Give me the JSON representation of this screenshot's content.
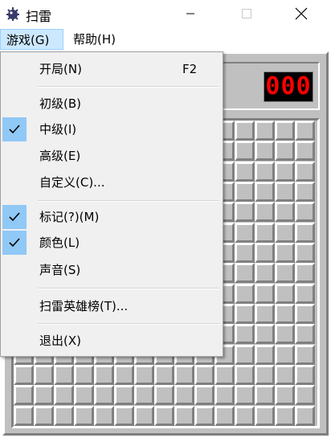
{
  "window": {
    "title": "扫雷",
    "app_icon": "mine-icon",
    "controls": {
      "minimize": "minimize-icon",
      "maximize": "maximize-icon",
      "close": "close-icon"
    }
  },
  "menubar": {
    "game": "游戏(G)",
    "help": "帮助(H)"
  },
  "game_menu": {
    "items": [
      {
        "label": "开局(N)",
        "shortcut": "F2",
        "checked": false
      },
      {
        "label": "初级(B)",
        "checked": false
      },
      {
        "label": "中级(I)",
        "checked": true
      },
      {
        "label": "高级(E)",
        "checked": false
      },
      {
        "label": "自定义(C)...",
        "checked": false
      },
      {
        "label": "标记(?)(M)",
        "checked": true
      },
      {
        "label": "颜色(L)",
        "checked": true
      },
      {
        "label": "声音(S)",
        "checked": false
      },
      {
        "label": "扫雷英雄榜(T)...",
        "checked": false
      },
      {
        "label": "退出(X)",
        "checked": false
      }
    ]
  },
  "game": {
    "mine_counter": "000"
  },
  "colors": {
    "menu_highlight": "#cce8ff",
    "check_background": "#90c8f6",
    "counter_digits": "#ff0000",
    "board_gray": "#c0c0c0"
  }
}
